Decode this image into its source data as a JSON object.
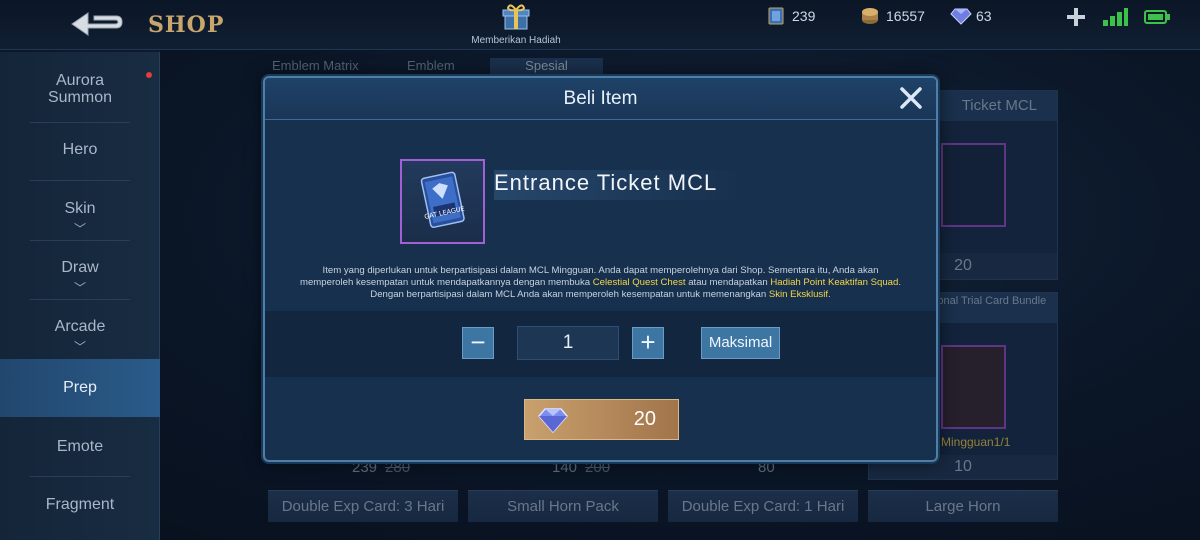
{
  "topbar": {
    "title": "SHOP",
    "gift_label": "Memberikan Hadiah",
    "currencies": [
      {
        "icon": "ticket-icon",
        "value": "239"
      },
      {
        "icon": "battle-point-coin-icon",
        "value": "16557"
      },
      {
        "icon": "diamond-icon",
        "value": "63"
      }
    ]
  },
  "sidebar": {
    "items": [
      {
        "label": "Aurora Summon"
      },
      {
        "label": "Hero"
      },
      {
        "label": "Skin"
      },
      {
        "label": "Draw"
      },
      {
        "label": "Arcade"
      },
      {
        "label": "Prep"
      },
      {
        "label": "Emote"
      },
      {
        "label": "Fragment"
      }
    ]
  },
  "background": {
    "tabs": [
      "Emblem Matrix",
      "Emblem",
      "Spesial"
    ],
    "cards": [
      {
        "title": "Ticket MCL",
        "price": "20"
      },
      {
        "title": "ational Trial Card Bundle",
        "limit": "Mingguan1/1",
        "price": "10"
      }
    ],
    "prices": [
      {
        "value": "239",
        "old": "280"
      },
      {
        "value": "140",
        "old": "200"
      },
      {
        "value": "80"
      },
      {
        "value": "10"
      }
    ],
    "bottom_labels": [
      "Double Exp Card: 3 Hari",
      "Small Horn Pack",
      "Double Exp Card: 1 Hari",
      "Large Horn"
    ]
  },
  "modal": {
    "title": "Beli Item",
    "item_name": "Entrance Ticket MCL",
    "item_art_text": "GAT LEAGUE",
    "desc_part1": "Item yang diperlukan untuk berpartisipasi dalam MCL Mingguan. Anda dapat memperolehnya dari Shop. Sementara itu, Anda akan memperoleh kesempatan untuk mendapatkannya dengan membuka ",
    "desc_hl1": "Celestial Quest Chest",
    "desc_part2": " atau mendapatkan ",
    "desc_hl2": "Hadiah Point Keaktifan Squad",
    "desc_part3": ". Dengan berpartisipasi dalam MCL Anda akan memperoleh kesempatan untuk memenangkan ",
    "desc_hl3": "Skin Eksklusif",
    "desc_part4": ".",
    "quantity": "1",
    "minus": "−",
    "plus": "+",
    "max_label": "Maksimal",
    "price": "20"
  },
  "colors": {
    "accent_blue": "#3e76a3",
    "highlight_yellow": "#f3d54c",
    "buy_gold": "#c9a06e",
    "title_gold": "#c9a66b",
    "item_border_purple": "#a35fd6"
  }
}
